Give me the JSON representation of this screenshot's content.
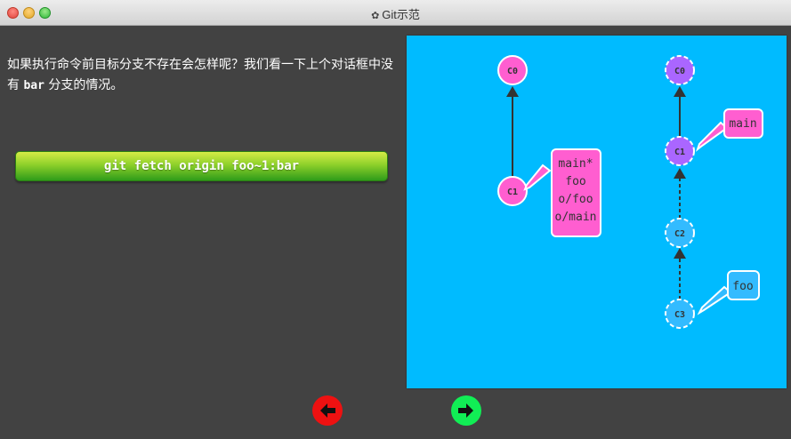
{
  "window": {
    "title": "Git示范",
    "title_icon": "gear-icon"
  },
  "description": {
    "text_before": "如果执行命令前目标分支不存在会怎样呢？我们看一下上个对话框中没有 ",
    "code": "bar",
    "text_after": " 分支的情况。"
  },
  "command": {
    "label": "git fetch origin foo~1:bar"
  },
  "colors": {
    "panel_bg": "#00bbff",
    "local_commit": "#ff5ed0",
    "remote_commit": "#aa66ff",
    "pending_commit": "#33bbff",
    "command_top": "#d6ec46",
    "command_bottom": "#2f9c1a",
    "back_button": "#ee1111",
    "next_button": "#11ee55"
  },
  "local_repo": {
    "commits": [
      {
        "id": "C0"
      },
      {
        "id": "C1"
      }
    ],
    "branch_label": {
      "lines": [
        "main*",
        "foo",
        "o/foo",
        "o/main"
      ]
    }
  },
  "remote_repo": {
    "commits": [
      {
        "id": "C0"
      },
      {
        "id": "C1"
      },
      {
        "id": "C2"
      },
      {
        "id": "C3"
      }
    ],
    "branches": [
      {
        "name": "main",
        "points_to": "C1"
      },
      {
        "name": "foo",
        "points_to": "C3"
      }
    ]
  },
  "nav": {
    "back_icon": "arrow-left-icon",
    "next_icon": "arrow-right-icon"
  }
}
